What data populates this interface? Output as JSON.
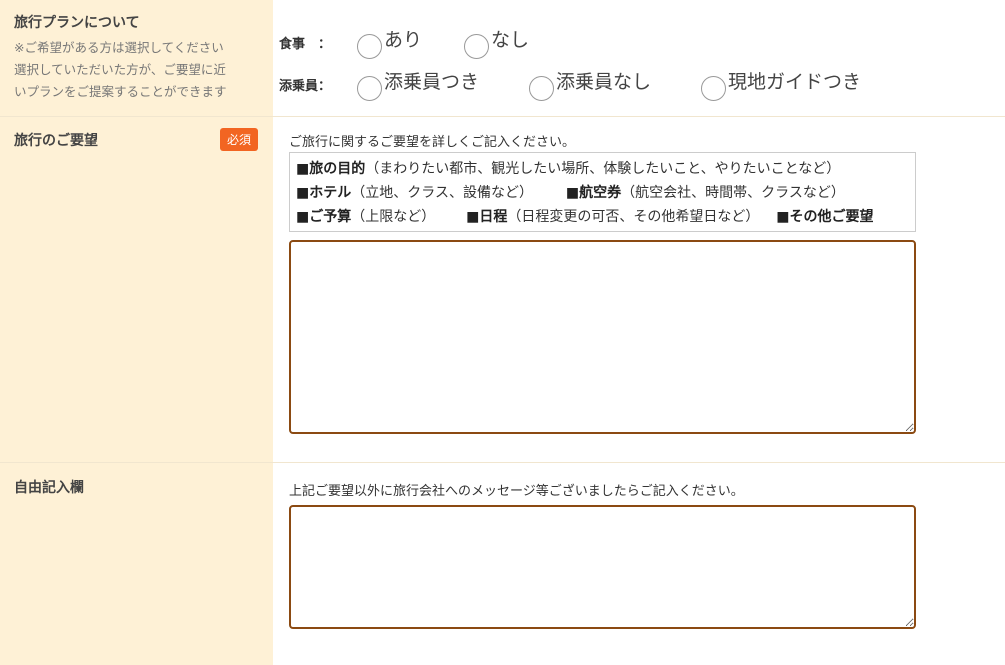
{
  "plan": {
    "title": "旅行プランについて",
    "note_lines": [
      "※ご希望がある方は選択してください",
      "選択していただいた方が、ご要望に近",
      "いプランをご提案することができます"
    ],
    "meal": {
      "label": "食事　：",
      "options": [
        "あり",
        "なし"
      ]
    },
    "escort": {
      "label": "添乗員：",
      "options": [
        "添乗員つき",
        "添乗員なし",
        "現地ガイドつき"
      ]
    }
  },
  "request": {
    "title": "旅行のご要望",
    "required_badge": "必須",
    "description": "ご旅行に関するご要望を詳しくご記入ください。",
    "guide": {
      "purpose_head": "■旅の目的",
      "purpose_text": "（まわりたい都市、観光したい場所、体験したいこと、やりたいことなど）",
      "hotel_head": "■ホテル",
      "hotel_text": "（立地、クラス、設備など）",
      "flight_head": "■航空券",
      "flight_text": "（航空会社、時間帯、クラスなど）",
      "budget_head": "■ご予算",
      "budget_text": "（上限など）",
      "schedule_head": "■日程",
      "schedule_text": "（日程変更の可否、その他希望日など）",
      "other_head": "■その他ご要望"
    },
    "textarea_value": ""
  },
  "free": {
    "title": "自由記入欄",
    "description": "上記ご要望以外に旅行会社へのメッセージ等ございましたらご記入ください。",
    "textarea_value": ""
  }
}
